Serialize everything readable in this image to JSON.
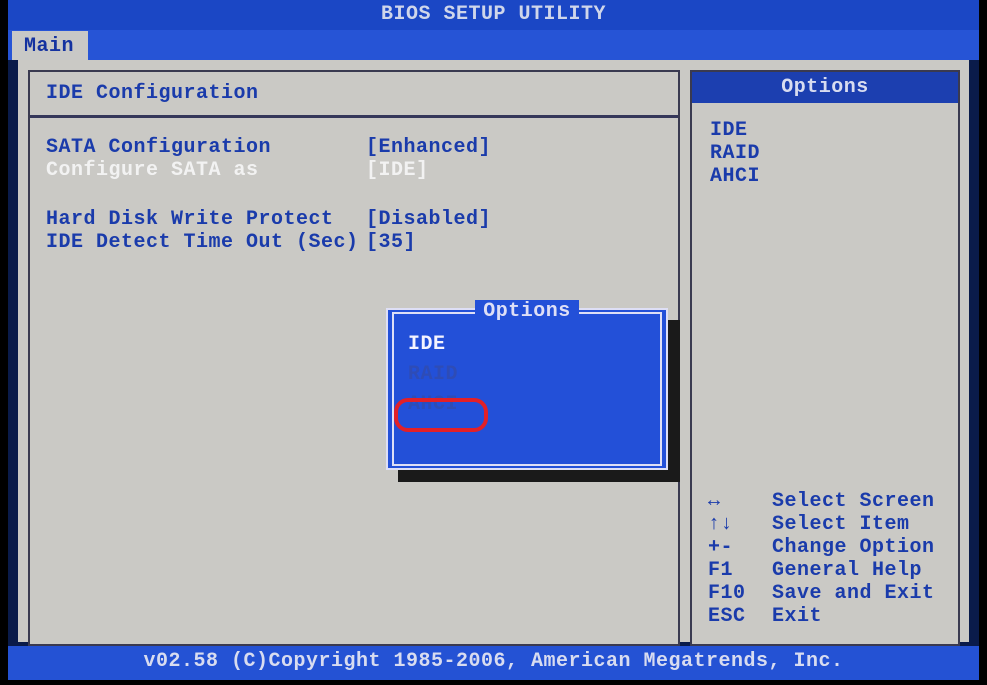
{
  "title": "BIOS SETUP UTILITY",
  "tab": "Main",
  "page": {
    "heading": "IDE Configuration",
    "rows": {
      "sata_cfg": {
        "label": "SATA Configuration",
        "value": "[Enhanced]"
      },
      "sata_as": {
        "label": "Configure SATA as",
        "value": "[IDE]"
      },
      "hd_wp": {
        "label": "Hard Disk Write Protect",
        "value": "[Disabled]"
      },
      "ide_timeout": {
        "label": "IDE Detect Time Out (Sec)",
        "value": "[35]"
      }
    }
  },
  "sidebar": {
    "title": "Options",
    "options": [
      "IDE",
      "RAID",
      "AHCI"
    ],
    "help": [
      {
        "key": "↔",
        "text": "Select Screen"
      },
      {
        "key": "↑↓",
        "text": "Select Item"
      },
      {
        "key": "+-",
        "text": "Change Option"
      },
      {
        "key": "F1",
        "text": "General Help"
      },
      {
        "key": "F10",
        "text": "Save and Exit"
      },
      {
        "key": "ESC",
        "text": "Exit"
      }
    ]
  },
  "popup": {
    "title": "Options",
    "items": [
      "IDE",
      "RAID",
      "AHCI"
    ],
    "selected": "IDE"
  },
  "footer": "v02.58 (C)Copyright 1985-2006, American Megatrends, Inc."
}
